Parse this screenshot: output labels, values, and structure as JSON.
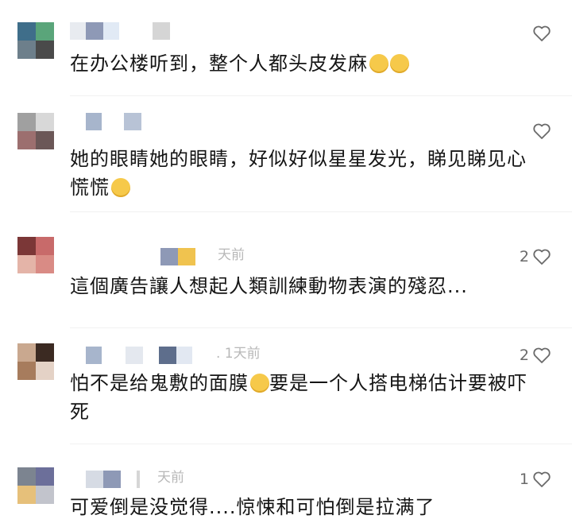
{
  "comments": [
    {
      "text": "在办公楼听到，整个人都头皮发麻",
      "emoji_count": 2,
      "likes": "",
      "meta": ""
    },
    {
      "text_line1": "她的眼睛她的眼睛，好似好似星星发光，睇见睇见心",
      "text_line2": "慌慌",
      "likes": "",
      "meta": ""
    },
    {
      "text": "這個廣告讓人想起人類訓練動物表演的殘忍...",
      "likes": "2",
      "meta": "天前"
    },
    {
      "text_part1": "怕不是给鬼敷的面膜",
      "text_part2": "要是一个人搭电梯估计要被吓",
      "text_line2": "死",
      "likes": "2",
      "meta": ". 1天前"
    },
    {
      "text": "可爱倒是没觉得....惊悚和可怕倒是拉满了",
      "likes": "1",
      "meta": "天前"
    }
  ],
  "colors": {
    "text": "#151515",
    "meta": "#b8b8b8",
    "icon": "#6a6a6a"
  },
  "icons": {
    "like": "heart-outline-icon"
  }
}
